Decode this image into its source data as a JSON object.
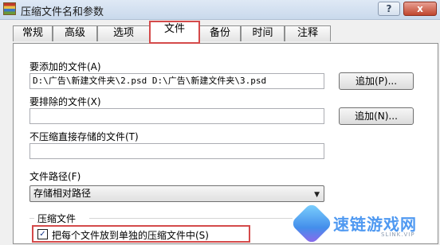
{
  "window": {
    "title": "压缩文件名和参数",
    "help_label": "?",
    "close_label": "x"
  },
  "tabs": [
    {
      "label": "常规"
    },
    {
      "label": "高级"
    },
    {
      "label": "选项"
    },
    {
      "label": "文件",
      "active": true
    },
    {
      "label": "备份"
    },
    {
      "label": "时间"
    },
    {
      "label": "注释"
    }
  ],
  "files": {
    "add_label": "要添加的文件(A)",
    "add_value": "D:\\广告\\新建文件夹\\2.psd D:\\广告\\新建文件夹\\3.psd",
    "add_button": "追加(P)...",
    "exclude_label": "要排除的文件(X)",
    "exclude_value": "",
    "exclude_button": "追加(N)...",
    "nocompress_label": "不压缩直接存储的文件(T)",
    "nocompress_value": ""
  },
  "paths": {
    "label": "文件路径(F)",
    "selected": "存储相对路径"
  },
  "archive": {
    "group_label": "压缩文件",
    "separate_label": "把每个文件放到单独的压缩文件中(S)",
    "separate_checked": true,
    "check_mark": "✓"
  },
  "watermark": {
    "text": "速链游戏网",
    "sub": "SLINK.VIP"
  },
  "colors": {
    "highlight": "#d44a4a",
    "title_bar": "#c9d9ec"
  }
}
